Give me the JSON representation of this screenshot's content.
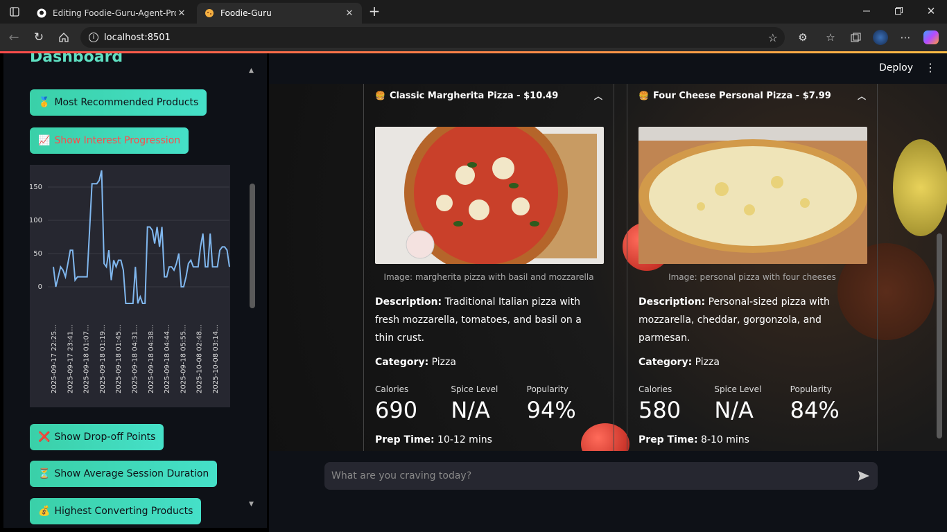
{
  "browser": {
    "tabs": [
      {
        "title": "Editing Foodie-Guru-Agent-Proje",
        "icon": "github-icon"
      },
      {
        "title": "Foodie-Guru",
        "icon": "foodie-favicon"
      }
    ],
    "url": "localhost:8501"
  },
  "sidebar": {
    "title": "Dashboard",
    "buttons": {
      "most_recommended": {
        "emoji": "🥇",
        "label": "Most Recommended Products"
      },
      "interest_progression": {
        "emoji": "📈",
        "label": "Show Interest Progression"
      },
      "dropoff": {
        "emoji": "❌",
        "label": "Show Drop-off Points"
      },
      "session_duration": {
        "emoji": "⏳",
        "label": "Show Average Session Duration"
      },
      "highest_converting": {
        "emoji": "💰",
        "label": "Highest Converting Products"
      }
    }
  },
  "chart_data": {
    "type": "line",
    "ylim": [
      -25,
      175
    ],
    "yticks": [
      0,
      50,
      100,
      150
    ],
    "xtick_labels": [
      "2025-09-17 22:25...",
      "2025-09-17 23:41...",
      "2025-09-18 01:07...",
      "2025-09-18 01:19...",
      "2025-09-18 01:45...",
      "2025-09-18 04:31...",
      "2025-09-18 04:38...",
      "2025-09-18 04:44...",
      "2025-09-18 05:55...",
      "2025-10-08 02:48...",
      "2025-10-08 03:14..."
    ],
    "values": [
      30,
      0,
      15,
      30,
      25,
      15,
      35,
      55,
      55,
      10,
      15,
      15,
      15,
      15,
      15,
      85,
      155,
      155,
      155,
      160,
      175,
      35,
      30,
      55,
      10,
      40,
      30,
      40,
      40,
      25,
      -25,
      -25,
      -25,
      -25,
      30,
      -25,
      -15,
      -25,
      -25,
      90,
      90,
      85,
      65,
      90,
      60,
      90,
      15,
      15,
      30,
      30,
      25,
      35,
      50,
      0,
      0,
      15,
      35,
      40,
      30,
      30,
      30,
      60,
      80,
      30,
      30,
      80,
      30,
      30,
      30,
      55,
      60,
      60,
      55,
      30
    ],
    "color": "#80b7ee"
  },
  "main": {
    "deploy": "Deploy",
    "products": [
      {
        "emoji": "🍔",
        "title": "Classic Margherita Pizza - $10.49",
        "caption": "Image: margherita pizza with basil and mozzarella",
        "desc_label": "Description:",
        "desc": " Traditional Italian pizza with fresh mozzarella, tomatoes, and basil on a thin crust.",
        "cat_label": "Category:",
        "category": " Pizza",
        "calories_label": "Calories",
        "calories": "690",
        "spice_label": "Spice Level",
        "spice": "N/A",
        "pop_label": "Popularity",
        "popularity": "94%",
        "prep_label": "Prep Time:",
        "prep": " 10-12 mins"
      },
      {
        "emoji": "🍔",
        "title": "Four Cheese Personal Pizza - $7.99",
        "caption": "Image: personal pizza with four cheeses",
        "desc_label": "Description:",
        "desc": " Personal-sized pizza with mozzarella, cheddar, gorgonzola, and parmesan.",
        "cat_label": "Category:",
        "category": " Pizza",
        "calories_label": "Calories",
        "calories": "580",
        "spice_label": "Spice Level",
        "spice": "N/A",
        "pop_label": "Popularity",
        "popularity": "84%",
        "prep_label": "Prep Time:",
        "prep": " 8-10 mins"
      }
    ],
    "chat_placeholder": "What are you craving today?"
  }
}
